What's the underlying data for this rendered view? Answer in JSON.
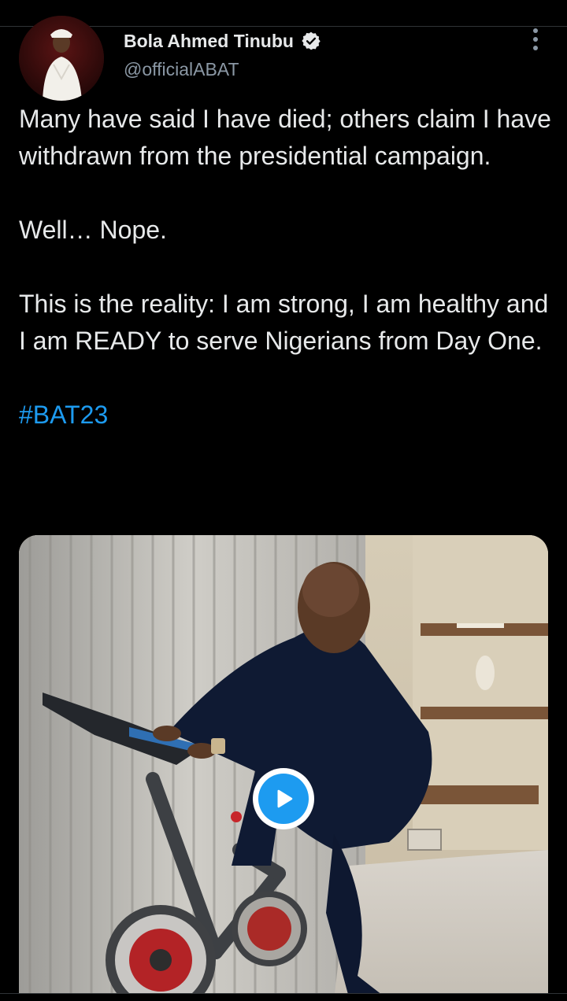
{
  "author": {
    "display_name": "Bola Ahmed Tinubu",
    "handle": "@officialABAT",
    "verified": true
  },
  "tweet": {
    "paragraph_1": "Many have said I have died; others claim I have withdrawn from the presidential campaign.",
    "paragraph_2": "Well… Nope.",
    "paragraph_3": "This is the reality: I am strong, I am healthy and I am READY to serve Nigerians from Day One.",
    "hashtag": "#BAT23"
  },
  "icons": {
    "verified": "verified-badge-icon",
    "more": "more-vertical-icon",
    "play": "play-icon"
  },
  "colors": {
    "background": "#000000",
    "text_primary": "#e7e9ea",
    "text_secondary": "#8b98a5",
    "accent": "#1d9bf0"
  }
}
